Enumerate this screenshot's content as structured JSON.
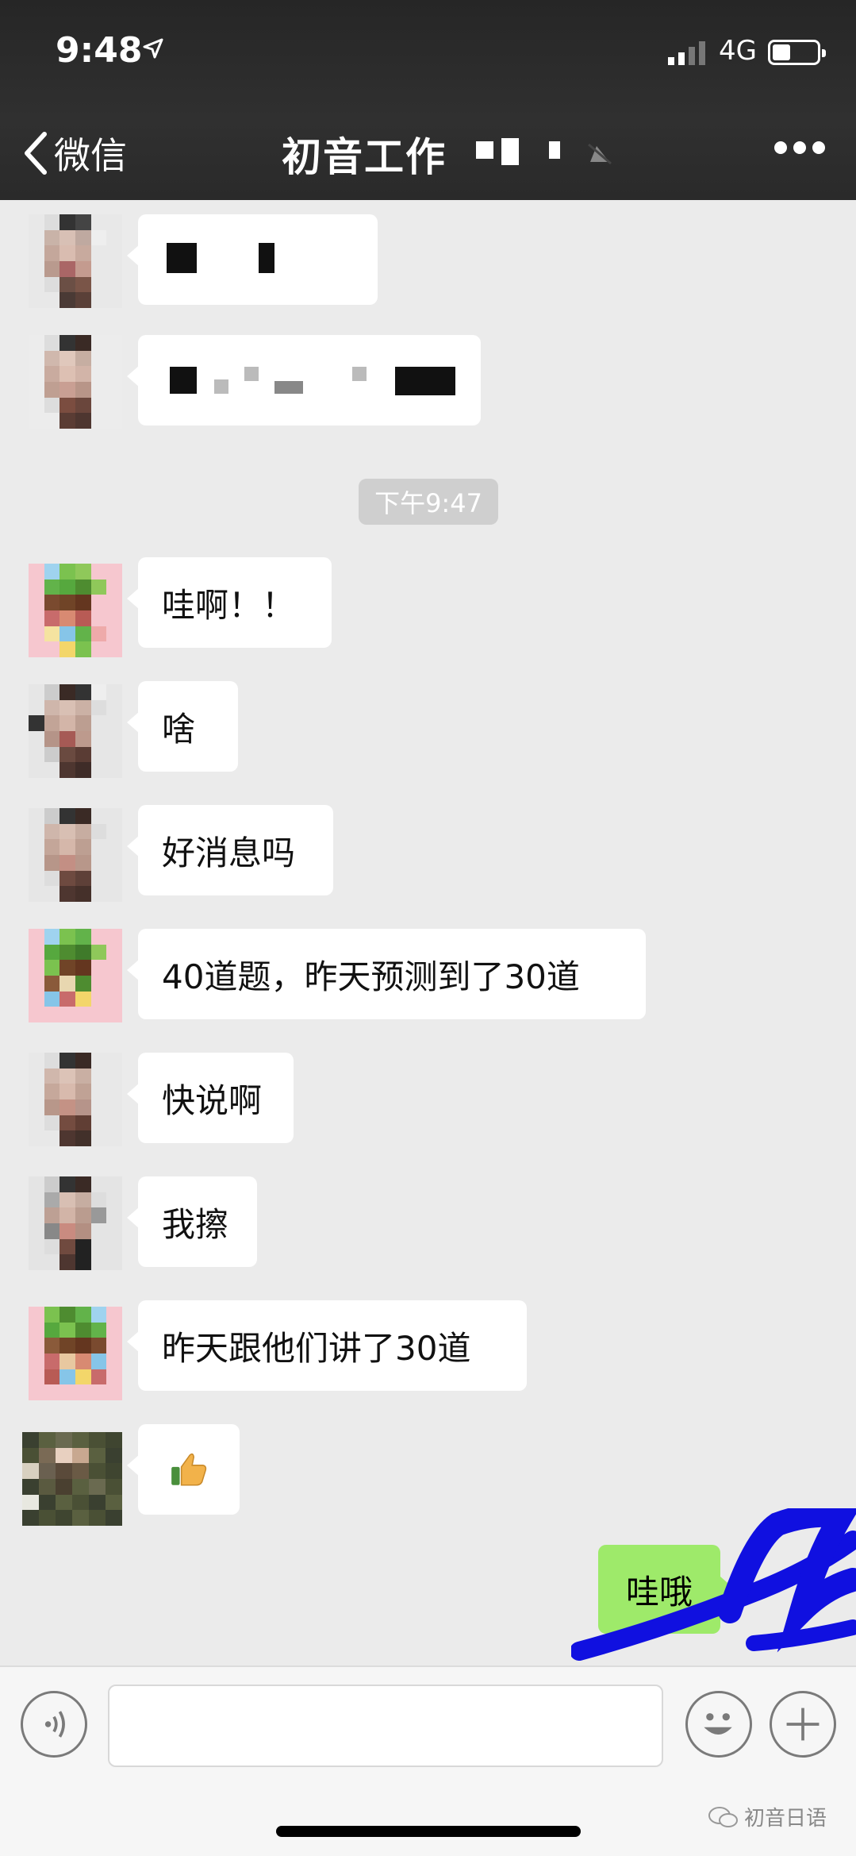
{
  "status_bar": {
    "time": "9:48",
    "network": "4G"
  },
  "nav": {
    "back_label": "微信",
    "title": "初音工作"
  },
  "messages": [
    {
      "text": ""
    },
    {
      "text": ""
    },
    {
      "text": "哇啊！！"
    },
    {
      "text": "啥"
    },
    {
      "text": "好消息吗"
    },
    {
      "text": "40道题，昨天预测到了30道"
    },
    {
      "text": "快说啊"
    },
    {
      "text": "我擦"
    },
    {
      "text": "昨天跟他们讲了30道"
    },
    {
      "text": "👍"
    }
  ],
  "timestamp": "下午9:47",
  "outgoing": {
    "text": "哇哦"
  },
  "input": {
    "placeholder": ""
  },
  "watermark": "初音日语",
  "colors": {
    "outgoing_bubble": "#9eea6a",
    "nav_bg": "#2d2d2d",
    "chat_bg": "#ebebeb"
  }
}
